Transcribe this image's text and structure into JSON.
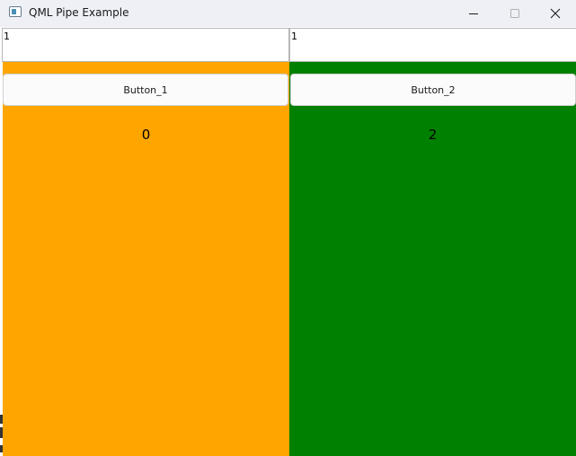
{
  "window": {
    "title": "QML Pipe Example",
    "icons": [
      "app-window-icon",
      "minimize-icon",
      "maximize-icon",
      "close-icon"
    ]
  },
  "inputs": {
    "left_value": "1",
    "right_value": "1"
  },
  "left_panel": {
    "color": "#FFA500",
    "button_label": "Button_1",
    "counter": "0"
  },
  "right_panel": {
    "color": "#008000",
    "button_label": "Button_2",
    "counter": "2"
  }
}
